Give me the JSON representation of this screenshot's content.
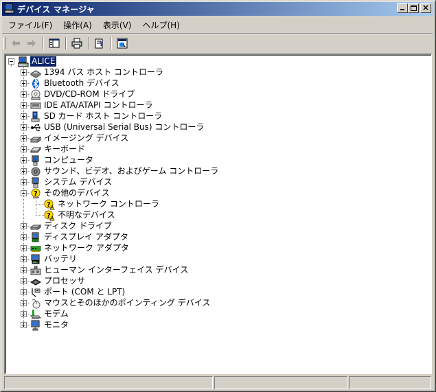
{
  "window": {
    "title": "デバイス マネージャ"
  },
  "menu": [
    {
      "label": "ファイル(F)"
    },
    {
      "label": "操作(A)"
    },
    {
      "label": "表示(V)"
    },
    {
      "label": "ヘルプ(H)"
    }
  ],
  "toolbar": {
    "buttons": [
      "back-icon",
      "forward-icon",
      "show-hide-tree-icon",
      "print-icon",
      "properties-icon",
      "help-icon"
    ]
  },
  "tree": {
    "root": {
      "label": "ALICE",
      "icon": "computer-icon",
      "selected": true
    },
    "items": [
      {
        "label": "1394 バス ホスト コントローラ",
        "icon": "bus-controller-icon"
      },
      {
        "label": "Bluetooth デバイス",
        "icon": "bluetooth-icon"
      },
      {
        "label": "DVD/CD-ROM ドライブ",
        "icon": "cdrom-icon"
      },
      {
        "label": "IDE ATA/ATAPI コントローラ",
        "icon": "ide-controller-icon"
      },
      {
        "label": "SD カード ホスト コントローラ",
        "icon": "sd-card-icon"
      },
      {
        "label": "USB (Universal Serial Bus) コントローラ",
        "icon": "usb-icon"
      },
      {
        "label": "イメージング デバイス",
        "icon": "scanner-icon"
      },
      {
        "label": "キーボード",
        "icon": "keyboard-icon"
      },
      {
        "label": "コンピュータ",
        "icon": "computer-small-icon"
      },
      {
        "label": "サウンド、ビデオ、およびゲーム コントローラ",
        "icon": "speaker-icon"
      },
      {
        "label": "システム デバイス",
        "icon": "system-device-icon"
      },
      {
        "label": "その他のデバイス",
        "icon": "unknown-device-icon",
        "expanded": true,
        "children": [
          {
            "label": "ネットワーク コントローラ",
            "icon": "warning-device-icon"
          },
          {
            "label": "不明なデバイス",
            "icon": "warning-device-icon"
          }
        ]
      },
      {
        "label": "ディスク ドライブ",
        "icon": "disk-drive-icon"
      },
      {
        "label": "ディスプレイ アダプタ",
        "icon": "display-adapter-icon"
      },
      {
        "label": "ネットワーク アダプタ",
        "icon": "network-adapter-icon"
      },
      {
        "label": "バッテリ",
        "icon": "battery-icon"
      },
      {
        "label": "ヒューマン インターフェイス デバイス",
        "icon": "hid-icon"
      },
      {
        "label": "プロセッサ",
        "icon": "processor-icon"
      },
      {
        "label": "ポート (COM と LPT)",
        "icon": "port-icon"
      },
      {
        "label": "マウスとそのほかのポインティング デバイス",
        "icon": "mouse-icon"
      },
      {
        "label": "モデム",
        "icon": "modem-icon"
      },
      {
        "label": "モニタ",
        "icon": "monitor-icon"
      }
    ]
  },
  "colors": {
    "titlebar_start": "#0a246a",
    "titlebar_end": "#a6caf0",
    "selection": "#0a246a",
    "face": "#d4d0c8"
  }
}
